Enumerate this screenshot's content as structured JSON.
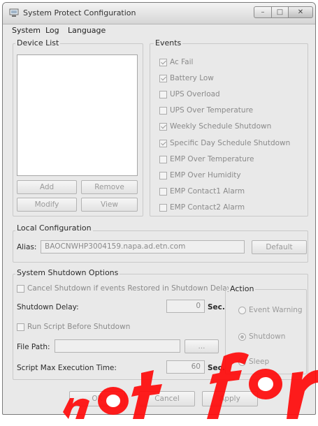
{
  "window": {
    "title": "System Protect Configuration"
  },
  "menu": [
    "System",
    "Log",
    "Language"
  ],
  "device_list": {
    "label": "Device List",
    "items": []
  },
  "device_buttons": {
    "add": "Add",
    "remove": "Remove",
    "modify": "Modify",
    "view": "View"
  },
  "events": {
    "label": "Events",
    "items": [
      {
        "label": "Ac Fail",
        "checked": true
      },
      {
        "label": "Battery Low",
        "checked": true
      },
      {
        "label": "UPS Overload",
        "checked": false
      },
      {
        "label": "UPS Over Temperature",
        "checked": false
      },
      {
        "label": "Weekly Schedule Shutdown",
        "checked": true
      },
      {
        "label": "Specific Day Schedule Shutdown",
        "checked": true
      },
      {
        "label": "EMP Over Temperature",
        "checked": false
      },
      {
        "label": "EMP Over Humidity",
        "checked": false
      },
      {
        "label": "EMP Contact1 Alarm",
        "checked": false
      },
      {
        "label": "EMP Contact2 Alarm",
        "checked": false
      }
    ]
  },
  "local_config": {
    "label": "Local Configuration",
    "alias_label": "Alias:",
    "alias_value": "BAOCNWHP3004159.napa.ad.etn.com",
    "default_button": "Default"
  },
  "shutdown": {
    "label": "System Shutdown Options",
    "cancel_cb": {
      "label": "Cancel Shutdown if events Restored in Shutdown Delay",
      "checked": false
    },
    "delay_label": "Shutdown Delay:",
    "delay_value": "0",
    "delay_unit": "Sec.",
    "run_script_cb": {
      "label": "Run Script Before Shutdown",
      "checked": false
    },
    "file_path_label": "File Path:",
    "file_path_value": "",
    "browse_button": "...",
    "max_time_label": "Script Max Execution Time:",
    "max_time_value": "60",
    "max_time_unit": "Sec."
  },
  "action": {
    "label": "Action",
    "options": [
      {
        "label": "Event Warning",
        "selected": false
      },
      {
        "label": "Shutdown",
        "selected": true
      },
      {
        "label": "Sleep",
        "selected": false
      }
    ]
  },
  "footer": {
    "ok": "OK",
    "cancel": "Cancel",
    "apply": "Apply"
  },
  "watermark": {
    "color": "#ff0a0a"
  }
}
